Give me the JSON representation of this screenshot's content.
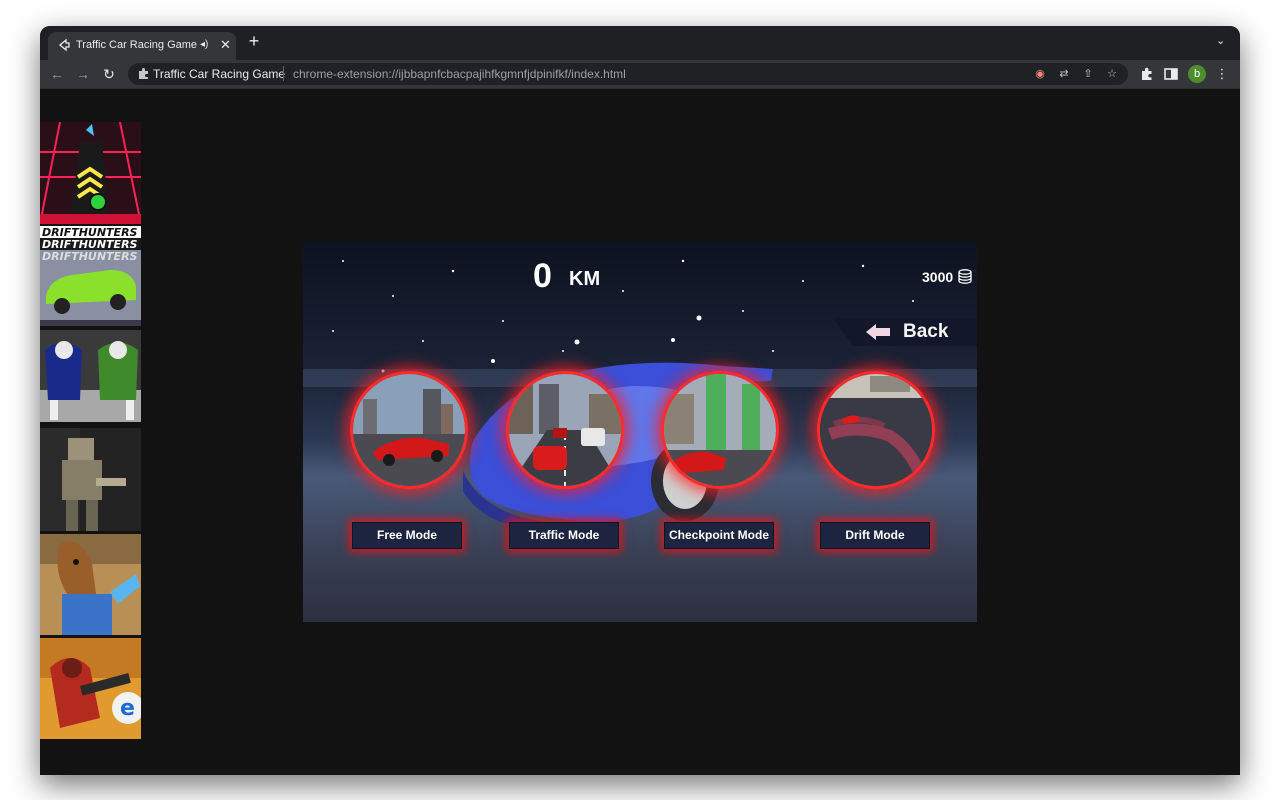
{
  "browser": {
    "tab_title": "Traffic Car Racing Game",
    "site_name": "Traffic Car Racing Game",
    "url": "chrome-extension://ijbbapnfcbacpajihfkgmnfjdpinifkf/index.html",
    "profile_initial": "b",
    "icons": [
      "back-icon",
      "forward-icon",
      "reload-icon",
      "extension-icon",
      "translate-icon",
      "share-icon",
      "bookmark-star-icon",
      "puzzle-icon",
      "side-panel-icon",
      "menu-icon"
    ]
  },
  "sidebar": {
    "thumbnails": [
      {
        "name": "slope-game-thumb"
      },
      {
        "name": "drift-hunters-thumb",
        "text": "DRIFTHUNTERS"
      },
      {
        "name": "robots-thumb"
      },
      {
        "name": "soldiers-thumb"
      },
      {
        "name": "horse-thumb"
      },
      {
        "name": "shooter-thumb"
      }
    ]
  },
  "game": {
    "distance_value": "0",
    "distance_unit": "KM",
    "coins": "3000",
    "back_label": "Back",
    "modes": [
      {
        "label": "Free Mode"
      },
      {
        "label": "Traffic Mode"
      },
      {
        "label": "Checkpoint Mode"
      },
      {
        "label": "Drift Mode"
      }
    ],
    "colors": {
      "glow": "#ff2b2b",
      "button_bg": "#1d2440",
      "car": "#3b4fd8"
    }
  }
}
